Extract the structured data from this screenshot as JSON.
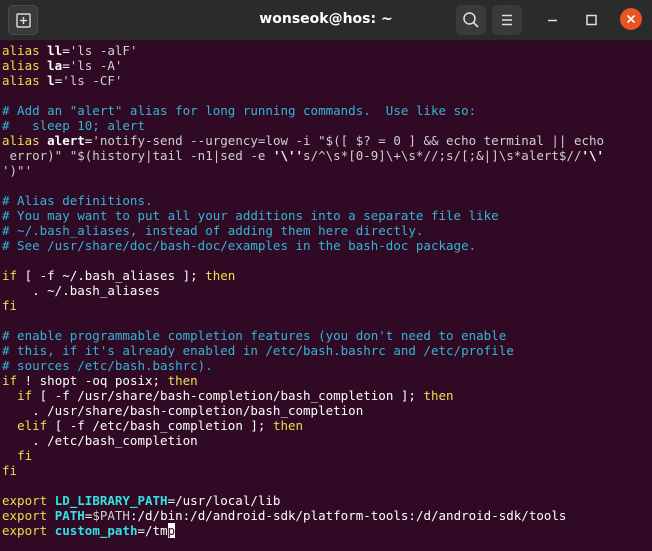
{
  "window": {
    "title": "wonseok@hos: ~"
  },
  "titlebar_icons": {
    "new_tab": "new-tab-icon",
    "search": "search-icon",
    "menu": "hamburger-menu-icon",
    "minimize": "minimize-icon",
    "maximize": "maximize-icon",
    "close": "close-icon"
  },
  "colors": {
    "terminal_bg": "#300a24",
    "titlebar_bg": "#2b2b2b",
    "comment": "#34b4d5",
    "keyword": "#e9e04c",
    "close_button": "#e95420"
  },
  "terminal": {
    "lines": [
      [
        {
          "t": "alias ",
          "c": "kw"
        },
        {
          "t": "ll",
          "c": "b"
        },
        {
          "t": "=",
          "c": ""
        },
        {
          "t": "'ls -alF'",
          "c": "str"
        }
      ],
      [
        {
          "t": "alias ",
          "c": "kw"
        },
        {
          "t": "la",
          "c": "b"
        },
        {
          "t": "=",
          "c": ""
        },
        {
          "t": "'ls -A'",
          "c": "str"
        }
      ],
      [
        {
          "t": "alias ",
          "c": "kw"
        },
        {
          "t": "l",
          "c": "b"
        },
        {
          "t": "=",
          "c": ""
        },
        {
          "t": "'ls -CF'",
          "c": "str"
        }
      ],
      [],
      [
        {
          "t": "# Add an \"alert\" alias for long running commands.  Use like so:",
          "c": "cm"
        }
      ],
      [
        {
          "t": "#   sleep 10; alert",
          "c": "cm"
        }
      ],
      [
        {
          "t": "alias ",
          "c": "kw"
        },
        {
          "t": "alert",
          "c": "b"
        },
        {
          "t": "=",
          "c": ""
        },
        {
          "t": "'notify-send --urgency=low -i \"$([ $? = 0 ] && echo terminal || echo",
          "c": "str"
        }
      ],
      [
        {
          "t": " error)\" \"$(history|tail -n1|sed -e ",
          "c": "str"
        },
        {
          "t": "'\\''",
          "c": "b"
        },
        {
          "t": "s/^\\s*[0-9]\\+\\s*//;s/[;&|]\\s*alert$//",
          "c": "str"
        },
        {
          "t": "'\\'",
          "c": "b"
        }
      ],
      [
        {
          "t": "')\"'",
          "c": "str"
        }
      ],
      [],
      [
        {
          "t": "# Alias definitions.",
          "c": "cm"
        }
      ],
      [
        {
          "t": "# You may want to put all your additions into a separate file like",
          "c": "cm"
        }
      ],
      [
        {
          "t": "# ~/.bash_aliases, instead of adding them here directly.",
          "c": "cm"
        }
      ],
      [
        {
          "t": "# See /usr/share/doc/bash-doc/examples in the bash-doc package.",
          "c": "cm"
        }
      ],
      [],
      [
        {
          "t": "if",
          "c": "kw"
        },
        {
          "t": " [ -f ~/.bash_aliases ]; ",
          "c": ""
        },
        {
          "t": "then",
          "c": "kw"
        }
      ],
      [
        {
          "t": "    . ~/.bash_aliases",
          "c": ""
        }
      ],
      [
        {
          "t": "fi",
          "c": "kw"
        }
      ],
      [],
      [
        {
          "t": "# enable programmable completion features (you don't need to enable",
          "c": "cm"
        }
      ],
      [
        {
          "t": "# this, if it's already enabled in /etc/bash.bashrc and /etc/profile",
          "c": "cm"
        }
      ],
      [
        {
          "t": "# sources /etc/bash.bashrc).",
          "c": "cm"
        }
      ],
      [
        {
          "t": "if",
          "c": "kw"
        },
        {
          "t": " ! shopt -oq posix; ",
          "c": ""
        },
        {
          "t": "then",
          "c": "kw"
        }
      ],
      [
        {
          "t": "  ",
          "c": ""
        },
        {
          "t": "if",
          "c": "kw"
        },
        {
          "t": " [ -f /usr/share/bash-completion/bash_completion ]; ",
          "c": ""
        },
        {
          "t": "then",
          "c": "kw"
        }
      ],
      [
        {
          "t": "    . /usr/share/bash-completion/bash_completion",
          "c": ""
        }
      ],
      [
        {
          "t": "  ",
          "c": ""
        },
        {
          "t": "elif",
          "c": "kw"
        },
        {
          "t": " [ -f /etc/bash_completion ]; ",
          "c": ""
        },
        {
          "t": "then",
          "c": "kw"
        }
      ],
      [
        {
          "t": "    . /etc/bash_completion",
          "c": ""
        }
      ],
      [
        {
          "t": "  ",
          "c": ""
        },
        {
          "t": "fi",
          "c": "kw"
        }
      ],
      [
        {
          "t": "fi",
          "c": "kw"
        }
      ],
      [],
      [
        {
          "t": "export ",
          "c": "kw"
        },
        {
          "t": "LD_LIBRARY_PATH",
          "c": "b cyan"
        },
        {
          "t": "=/usr/local/lib",
          "c": ""
        }
      ],
      [
        {
          "t": "export ",
          "c": "kw"
        },
        {
          "t": "PATH",
          "c": "b cyan"
        },
        {
          "t": "=",
          "c": ""
        },
        {
          "t": "$PATH",
          "c": "str"
        },
        {
          "t": ":/d/bin:/d/android-sdk/platform-tools:/d/android-sdk/tools",
          "c": ""
        }
      ],
      [
        {
          "t": "export ",
          "c": "kw"
        },
        {
          "t": "custom_path",
          "c": "b cyan"
        },
        {
          "t": "=/tm",
          "c": ""
        },
        {
          "t": "p",
          "c": "cursor"
        }
      ]
    ]
  }
}
